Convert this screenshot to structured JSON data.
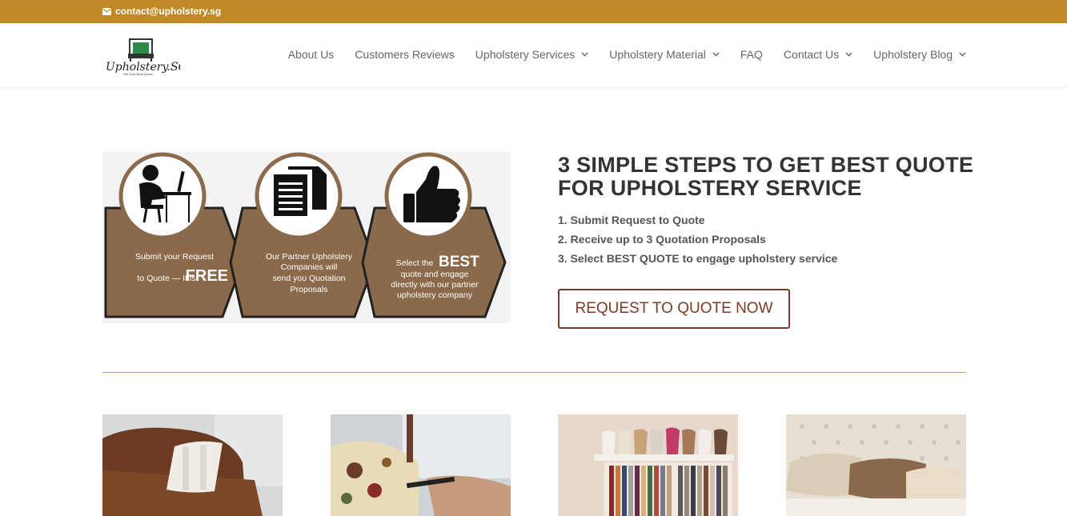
{
  "topbar": {
    "email": "contact@upholstery.sg",
    "icon": "envelope-icon",
    "color": "#c28a26"
  },
  "logo": {
    "text": "Upholstery.SG",
    "tagline": "Get Your Best Quote"
  },
  "nav": {
    "items": [
      {
        "label": "About Us",
        "dropdown": false
      },
      {
        "label": "Customers Reviews",
        "dropdown": false
      },
      {
        "label": "Upholstery Services",
        "dropdown": true
      },
      {
        "label": "Upholstery Material",
        "dropdown": true
      },
      {
        "label": "FAQ",
        "dropdown": false
      },
      {
        "label": "Contact Us",
        "dropdown": true
      },
      {
        "label": "Upholstery Blog",
        "dropdown": true
      }
    ]
  },
  "steps_graphic": {
    "step1": {
      "line1": "Submit your Request",
      "line2": "to Quote — It is",
      "emph": "FREE"
    },
    "step2": {
      "lines": [
        "Our Partner Upholstery",
        "Companies will",
        "send you Quotation",
        "Proposals"
      ]
    },
    "step3": {
      "pre": "Select the",
      "emph": "BEST",
      "lines": [
        "quote and engage",
        "directly with our partner",
        "upholstery company"
      ]
    },
    "accent": "#8a6a4a"
  },
  "main": {
    "headline": "3 SIMPLE STEPS TO GET BEST QUOTE FOR UPHOLSTERY SERVICE",
    "steps": [
      "1. Submit Request to Quote",
      "2. Receive up to 3 Quotation Proposals",
      "3. Select BEST QUOTE to engage upholstery service"
    ],
    "cta_label": "REQUEST TO QUOTE NOW",
    "cta_color": "#7a3b26"
  },
  "gallery": [
    "leather-sofa-image",
    "chair-upholstering-image",
    "cushions-fabric-image",
    "tufted-headboard-image"
  ]
}
